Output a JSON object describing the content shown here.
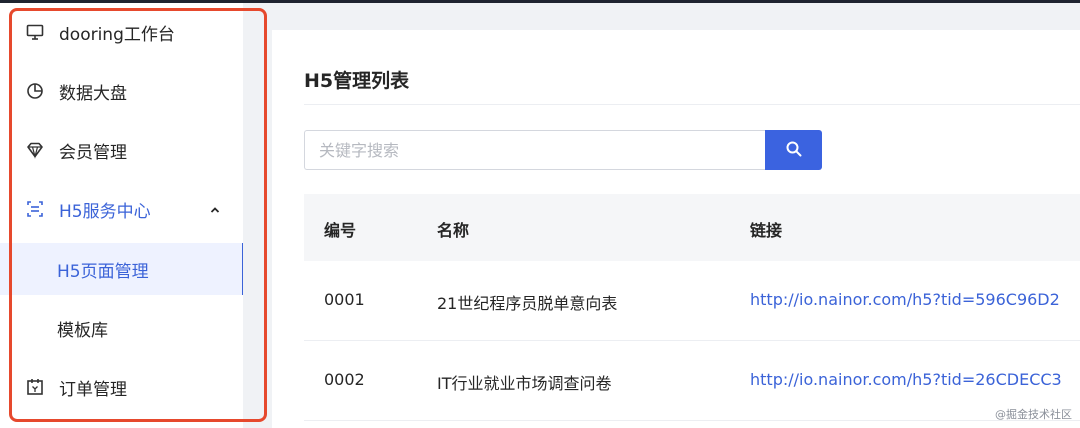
{
  "sidebar": {
    "items": [
      {
        "label": "dooring工作台",
        "icon": "monitor-icon"
      },
      {
        "label": "数据大盘",
        "icon": "pie-chart-icon"
      },
      {
        "label": "会员管理",
        "icon": "diamond-icon"
      },
      {
        "label": "H5服务中心",
        "icon": "scan-icon"
      },
      {
        "label": "H5页面管理"
      },
      {
        "label": "模板库"
      },
      {
        "label": "订单管理",
        "icon": "calendar-icon"
      }
    ],
    "accent": "#3b63d8"
  },
  "main": {
    "title": "H5管理列表",
    "search": {
      "placeholder": "关键字搜索",
      "value": ""
    },
    "table": {
      "headers": {
        "id": "编号",
        "name": "名称",
        "link": "链接"
      },
      "rows": [
        {
          "id": "0001",
          "name": "21世纪程序员脱单意向表",
          "link": "http://io.nainor.com/h5?tid=596C96D2"
        },
        {
          "id": "0002",
          "name": "IT行业就业市场调查问卷",
          "link": "http://io.nainor.com/h5?tid=26CDECC3"
        }
      ]
    }
  },
  "watermark": "@掘金技术社区",
  "colors": {
    "highlight_border": "#e6492d",
    "primary": "#3b63e0"
  }
}
